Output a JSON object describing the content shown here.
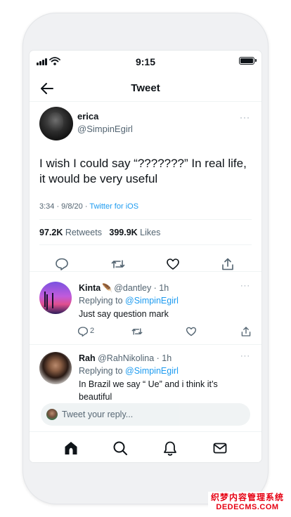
{
  "status_bar": {
    "time": "9:15"
  },
  "header": {
    "title": "Tweet"
  },
  "tweet": {
    "author_name": "erica",
    "author_handle": "@SimpinEgirl",
    "more": "···",
    "text": "I wish I could say “???????” In real life, it would be very useful",
    "timestamp": "3:34 · 9/8/20 · ",
    "client": "Twitter for iOS",
    "retweets_count": "97.2K",
    "retweets_label": " Retweets",
    "likes_count": "399.9K",
    "likes_label": " Likes"
  },
  "replies": [
    {
      "name": "Kinta",
      "verified_icon": "🪶",
      "handle": "@dantley",
      "time": " · 1h",
      "replying_prefix": "Replying to ",
      "replying_to": "@SimpinEgirl",
      "text": "Just say question mark",
      "reply_count": "2",
      "more": "···"
    },
    {
      "name": "Rah",
      "handle": "@RahNikolina",
      "time": " · 1h",
      "replying_prefix": "Replying to ",
      "replying_to": "@SimpinEgirl",
      "text": "In Brazil we say “ Ue” and i think it’s beautiful",
      "more": "···"
    }
  ],
  "compose": {
    "placeholder": "Tweet your reply..."
  },
  "watermark": {
    "line1": "织梦内容管理系统",
    "line2": "DEDECMS.COM"
  },
  "colors": {
    "accent": "#1d9bf0",
    "text": "#0f1419",
    "muted": "#536471",
    "border": "#eff3f4"
  },
  "icons": {
    "back": "arrow-left-icon",
    "reply": "comment-icon",
    "retweet": "retweet-icon",
    "like": "heart-icon",
    "share": "share-icon",
    "tabs": [
      "home-icon",
      "search-icon",
      "bell-icon",
      "mail-icon"
    ]
  }
}
